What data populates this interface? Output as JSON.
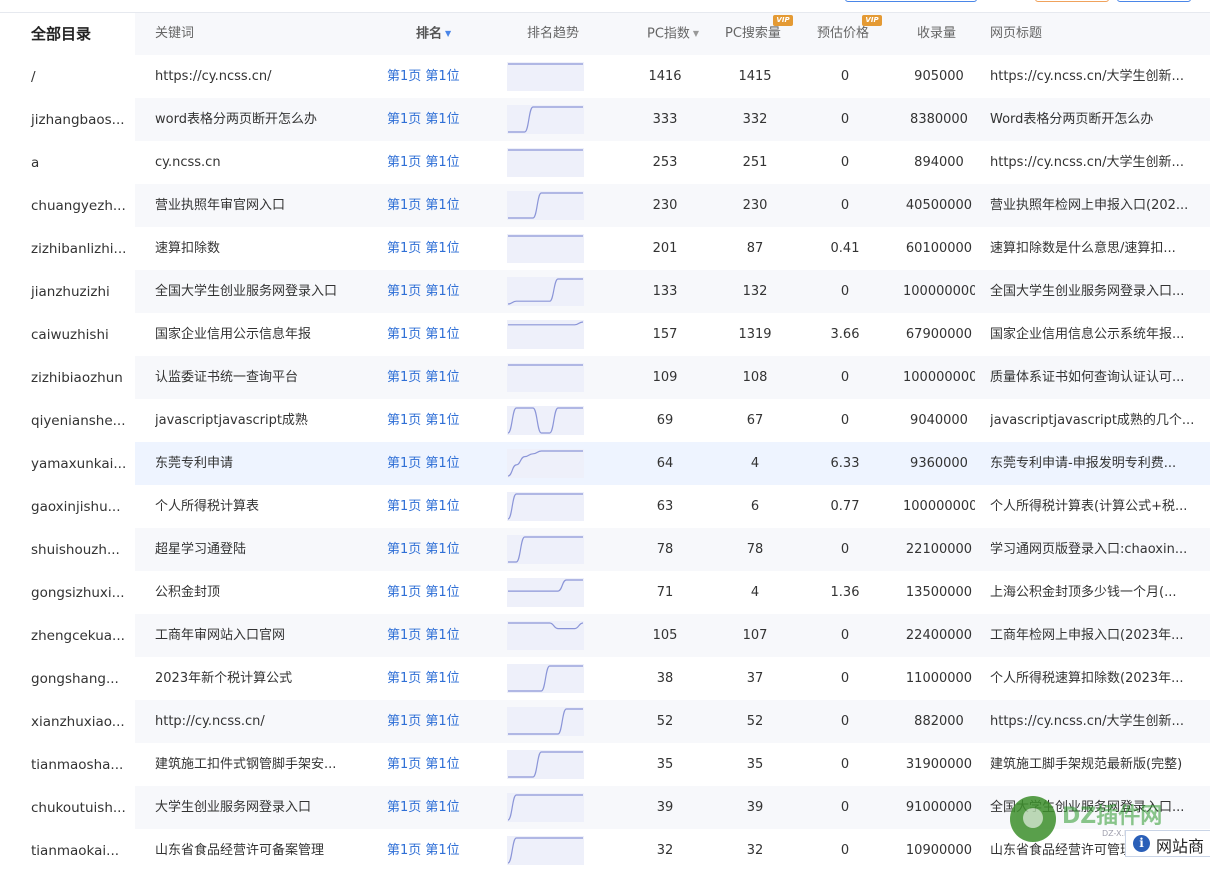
{
  "sidebar": {
    "title": "全部目录",
    "items": [
      "/",
      "jizhangbaos...",
      "a",
      "chuangyezh...",
      "zizhibanlizhi...",
      "jianzhuzizhi",
      "caiwuzhishi",
      "zizhibiaozhun",
      "qiyenianshe...",
      "yamaxunkai...",
      "gaoxinjishu...",
      "shuishouzh...",
      "gongsizhuxi...",
      "zhengcekua...",
      "gongshang...",
      "xianzhuxiao...",
      "tianmaosha...",
      "chukoutuish...",
      "tianmaokai..."
    ]
  },
  "columns": {
    "keyword": "关键词",
    "rank": "排名",
    "trend": "排名趋势",
    "pc_index": "PC指数",
    "pc_search": "PC搜索量",
    "price": "预估价格",
    "indexed": "收录量",
    "title": "网页标题",
    "vip": "VIP",
    "sort_caret": "▼"
  },
  "colors": {
    "accent": "#2f6fd6",
    "vip_badge": "#e49a34",
    "row_alt": "#f7f8fb",
    "row_highlight": "#eef4ff"
  },
  "rows": [
    {
      "keyword": "https://cy.ncss.cn/",
      "rank": "第1页 第1位",
      "pc_index": "1416",
      "pc_search": "1415",
      "price": "0",
      "indexed": "905000",
      "title": "https://cy.ncss.cn/大学生创新...",
      "trend": [
        1,
        1,
        1,
        1,
        1,
        1,
        1,
        1,
        1,
        1
      ]
    },
    {
      "keyword": "word表格分两页断开怎么办",
      "rank": "第1页 第1位",
      "pc_index": "333",
      "pc_search": "332",
      "price": "0",
      "indexed": "8380000",
      "title": "Word表格分两页断开怎么办",
      "trend": [
        10,
        10,
        10,
        1,
        1,
        1,
        1,
        1,
        1,
        1
      ]
    },
    {
      "keyword": "cy.ncss.cn",
      "rank": "第1页 第1位",
      "pc_index": "253",
      "pc_search": "251",
      "price": "0",
      "indexed": "894000",
      "title": "https://cy.ncss.cn/大学生创新...",
      "trend": [
        1,
        1,
        1,
        1,
        1,
        1,
        1,
        1,
        1,
        1
      ]
    },
    {
      "keyword": "营业执照年审官网入口",
      "rank": "第1页 第1位",
      "pc_index": "230",
      "pc_search": "230",
      "price": "0",
      "indexed": "40500000",
      "title": "营业执照年检网上申报入口(202...",
      "trend": [
        10,
        10,
        10,
        10,
        1,
        1,
        1,
        1,
        1,
        1
      ]
    },
    {
      "keyword": "速算扣除数",
      "rank": "第1页 第1位",
      "pc_index": "201",
      "pc_search": "87",
      "price": "0.41",
      "indexed": "60100000",
      "title": "速算扣除数是什么意思/速算扣...",
      "trend": [
        1,
        1,
        1,
        1,
        1,
        1,
        1,
        1,
        1,
        1
      ]
    },
    {
      "keyword": "全国大学生创业服务网登录入口",
      "rank": "第1页 第1位",
      "pc_index": "133",
      "pc_search": "132",
      "price": "0",
      "indexed": "100000000",
      "title": "全国大学生创业服务网登录入口...",
      "trend": [
        10,
        9,
        9,
        9,
        9,
        9,
        1,
        1,
        1,
        1
      ]
    },
    {
      "keyword": "国家企业信用公示信息年报",
      "rank": "第1页 第1位",
      "pc_index": "157",
      "pc_search": "1319",
      "price": "3.66",
      "indexed": "67900000",
      "title": "国家企业信用信息公示系统年报...",
      "trend": [
        2,
        2,
        2,
        2,
        2,
        2,
        2,
        2,
        2,
        1
      ]
    },
    {
      "keyword": "认监委证书统一查询平台",
      "rank": "第1页 第1位",
      "pc_index": "109",
      "pc_search": "108",
      "price": "0",
      "indexed": "100000000",
      "title": "质量体系证书如何查询认证认可...",
      "trend": [
        1,
        1,
        1,
        1,
        1,
        1,
        1,
        1,
        1,
        1
      ]
    },
    {
      "keyword": "javascriptjavascript成熟",
      "rank": "第1页 第1位",
      "pc_index": "69",
      "pc_search": "67",
      "price": "0",
      "indexed": "9040000",
      "title": "javascriptjavascript成熟的几个...",
      "trend": [
        10,
        1,
        1,
        1,
        10,
        10,
        1,
        1,
        1,
        1
      ]
    },
    {
      "keyword": "东莞专利申请",
      "rank": "第1页 第1位",
      "pc_index": "64",
      "pc_search": "4",
      "price": "6.33",
      "indexed": "9360000",
      "title": "东莞专利申请-申报发明专利费...",
      "trend": [
        10,
        6,
        3,
        2,
        1,
        1,
        1,
        1,
        1,
        1
      ]
    },
    {
      "keyword": "个人所得税计算表",
      "rank": "第1页 第1位",
      "pc_index": "63",
      "pc_search": "6",
      "price": "0.77",
      "indexed": "100000000",
      "title": "个人所得税计算表(计算公式+税...",
      "trend": [
        10,
        1,
        1,
        1,
        1,
        1,
        1,
        1,
        1,
        1
      ]
    },
    {
      "keyword": "超星学习通登陆",
      "rank": "第1页 第1位",
      "pc_index": "78",
      "pc_search": "78",
      "price": "0",
      "indexed": "22100000",
      "title": "学习通网页版登录入口:chaoxin...",
      "trend": [
        10,
        10,
        1,
        1,
        1,
        1,
        1,
        1,
        1,
        1
      ]
    },
    {
      "keyword": "公积金封顶",
      "rank": "第1页 第1位",
      "pc_index": "71",
      "pc_search": "4",
      "price": "1.36",
      "indexed": "13500000",
      "title": "上海公积金封顶多少钱一个月(...",
      "trend": [
        5,
        5,
        5,
        5,
        5,
        5,
        5,
        1,
        1,
        1
      ]
    },
    {
      "keyword": "工商年审网站入口官网",
      "rank": "第1页 第1位",
      "pc_index": "105",
      "pc_search": "107",
      "price": "0",
      "indexed": "22400000",
      "title": "工商年检网上申报入口(2023年...",
      "trend": [
        1,
        1,
        1,
        1,
        1,
        1,
        3,
        3,
        3,
        1
      ]
    },
    {
      "keyword": "2023年新个税计算公式",
      "rank": "第1页 第1位",
      "pc_index": "38",
      "pc_search": "37",
      "price": "0",
      "indexed": "11000000",
      "title": "个人所得税速算扣除数(2023年...",
      "trend": [
        10,
        10,
        10,
        10,
        10,
        1,
        1,
        1,
        1,
        1
      ]
    },
    {
      "keyword": "http://cy.ncss.cn/",
      "rank": "第1页 第1位",
      "pc_index": "52",
      "pc_search": "52",
      "price": "0",
      "indexed": "882000",
      "title": "https://cy.ncss.cn/大学生创新...",
      "trend": [
        10,
        10,
        10,
        10,
        10,
        10,
        10,
        1,
        1,
        1
      ]
    },
    {
      "keyword": "建筑施工扣件式钢管脚手架安...",
      "rank": "第1页 第1位",
      "pc_index": "35",
      "pc_search": "35",
      "price": "0",
      "indexed": "31900000",
      "title": "建筑施工脚手架规范最新版(完整)",
      "trend": [
        10,
        10,
        10,
        10,
        1,
        1,
        1,
        1,
        1,
        1
      ]
    },
    {
      "keyword": "大学生创业服务网登录入口",
      "rank": "第1页 第1位",
      "pc_index": "39",
      "pc_search": "39",
      "price": "0",
      "indexed": "91000000",
      "title": "全国大学生创业服务网登录入口...",
      "trend": [
        10,
        1,
        1,
        1,
        1,
        1,
        1,
        1,
        1,
        1
      ]
    },
    {
      "keyword": "山东省食品经营许可备案管理",
      "rank": "第1页 第1位",
      "pc_index": "32",
      "pc_search": "32",
      "price": "0",
      "indexed": "10900000",
      "title": "山东省食品经营许可管理...",
      "trend": [
        10,
        1,
        1,
        1,
        1,
        1,
        1,
        1,
        1,
        1
      ]
    }
  ],
  "watermark": {
    "text": "DZ插件网",
    "sub": "DZ-X.NET",
    "site": "网站商",
    "icon": "info-icon"
  }
}
